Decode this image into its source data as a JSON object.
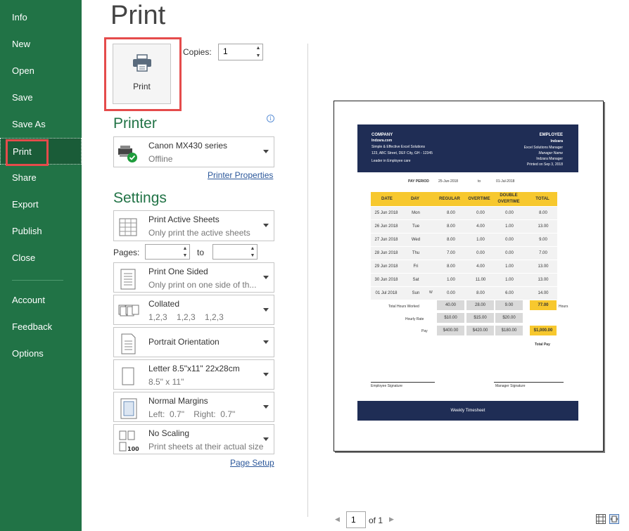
{
  "nav": {
    "items": [
      "Info",
      "New",
      "Open",
      "Save",
      "Save As",
      "Print",
      "Share",
      "Export",
      "Publish",
      "Close"
    ],
    "bottom_items": [
      "Account",
      "Feedback",
      "Options"
    ],
    "active": "Print"
  },
  "title": "Print",
  "print_button": {
    "label": "Print"
  },
  "copies": {
    "label": "Copies:",
    "value": "1"
  },
  "printer": {
    "heading": "Printer",
    "name": "Canon MX430 series",
    "status": "Offline",
    "properties_link": "Printer Properties"
  },
  "settings": {
    "heading": "Settings",
    "active_sheets": {
      "line1": "Print Active Sheets",
      "line2": "Only print the active sheets"
    },
    "pages": {
      "label": "Pages:",
      "to": "to"
    },
    "sided": {
      "line1": "Print One Sided",
      "line2": "Only print on one side of th..."
    },
    "collated": {
      "line1": "Collated",
      "line2": "1,2,3    1,2,3    1,2,3"
    },
    "orientation": {
      "line1": "Portrait Orientation"
    },
    "paper": {
      "line1": "Letter 8.5\"x11\" 22x28cm",
      "line2": "8.5\" x 11\""
    },
    "margins": {
      "line1": "Normal Margins",
      "line2": "Left:  0.7\"    Right:  0.7\""
    },
    "scaling": {
      "line1": "No Scaling",
      "line2": "Print sheets at their actual size",
      "icon_text": "100"
    },
    "page_setup_link": "Page Setup"
  },
  "preview": {
    "company": "COMPANY",
    "company_name": "Indzara.com",
    "company_tagline": "Simple & Effective Excel Solutions",
    "company_address": "123, ABC Street, DEF City, GH - 12345",
    "company_desc": "Leader in Employee care",
    "employee": "EMPLOYEE",
    "employee_name": "Indzara",
    "employee_role": "Excel Solutions Manager",
    "manager_name": "Manager Name",
    "employee_org": "Indzara Manager",
    "printed_on": "Printed on Sep 3, 2018",
    "pay_period_label": "PAY PERIOD",
    "pay_from": "25-Jun-2018",
    "pay_to_label": "to",
    "pay_to": "01-Jul-2018",
    "headers": [
      "DATE",
      "DAY",
      "REGULAR",
      "OVERTIME",
      "DOUBLE OVERTIME",
      "TOTAL"
    ],
    "rows": [
      [
        "25 Jun 2018",
        "Mon",
        "8.00",
        "0.00",
        "0.00",
        "8.00"
      ],
      [
        "26 Jun 2018",
        "Tue",
        "8.00",
        "4.00",
        "1.00",
        "13.00"
      ],
      [
        "27 Jun 2018",
        "Wed",
        "8.00",
        "1.00",
        "0.00",
        "9.00"
      ],
      [
        "28 Jun 2018",
        "Thu",
        "7.00",
        "0.00",
        "0.00",
        "7.00"
      ],
      [
        "29 Jun 2018",
        "Fri",
        "8.00",
        "4.00",
        "1.00",
        "13.00"
      ],
      [
        "30 Jun 2018",
        "Sat",
        "1.00",
        "11.00",
        "1.00",
        "13.00"
      ],
      [
        "01 Jul 2018",
        "Sun",
        "0.00",
        "8.00",
        "6.00",
        "14.00"
      ]
    ],
    "sun_marker": "W",
    "total_hours_label": "Total Hours Worked",
    "total_hours": [
      "40.00",
      "28.00",
      "9.00"
    ],
    "total_hours_sum": "77.00",
    "hours_unit": "Hours",
    "hourly_rate_label": "Hourly Rate",
    "hourly_rates": [
      "$10.00",
      "$15.00",
      "$20.00"
    ],
    "pay_label": "Pay",
    "pays": [
      "$400.00",
      "$420.00",
      "$180.00"
    ],
    "total_pay": "$1,000.00",
    "total_pay_label": "Total Pay",
    "employee_sig": "Employee Signature",
    "manager_sig": "Manager Signature",
    "footer": "Weekly Timesheet"
  },
  "pager": {
    "current": "1",
    "of_label": "of 1"
  },
  "colors": {
    "nav_bg": "#217346",
    "accent": "#217346",
    "highlight": "#e54b4b",
    "sheet_header": "#1f2d55",
    "sheet_yellow": "#f7c82e"
  }
}
